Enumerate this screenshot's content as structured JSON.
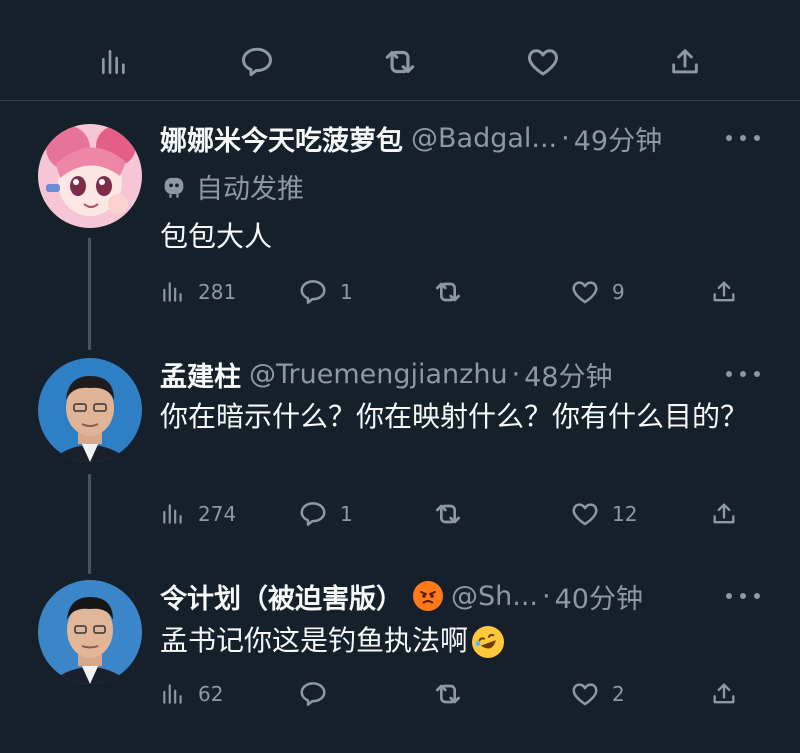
{
  "top_actions": [
    {
      "icon": "views-icon"
    },
    {
      "icon": "reply-icon"
    },
    {
      "icon": "retweet-icon"
    },
    {
      "icon": "like-icon"
    },
    {
      "icon": "share-icon"
    }
  ],
  "tweets": [
    {
      "name": "娜娜米今天吃菠萝包",
      "handle": "@Badgal...",
      "sep": "·",
      "time": "49分钟",
      "automated_label": "自动发推",
      "text": "包包大人",
      "views": "281",
      "replies": "1",
      "retweets": "",
      "likes": "9"
    },
    {
      "name": "孟建柱",
      "handle": "@Truemengjianzhu",
      "sep": "·",
      "time": "48分钟",
      "text": "你在暗示什么？你在映射什么？你有什么目的？",
      "views": "274",
      "replies": "1",
      "retweets": "",
      "likes": "12"
    },
    {
      "name": "令计划（被迫害版）",
      "handle": "@Sh...",
      "sep": "·",
      "time": "40分钟",
      "text": "孟书记你这是钓鱼执法啊",
      "views": "62",
      "replies": "",
      "retweets": "",
      "likes": "2"
    }
  ],
  "colors": {
    "background": "#15202b",
    "muted": "#8b98a5",
    "text": "#f7f9f9",
    "divider": "#38444d"
  }
}
